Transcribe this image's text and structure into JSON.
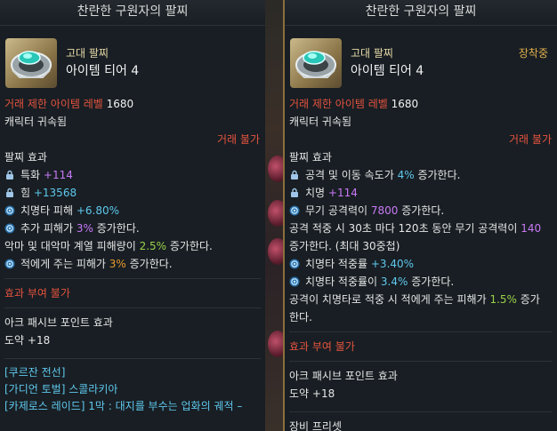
{
  "left": {
    "title": "찬란한 구원자의 팔찌",
    "grade": "고대 팔찌",
    "tier": "아이템 티어 4",
    "level_label": "거래 제한 아이템 레벨",
    "level_value": "1680",
    "bound": "캐릭터 귀속됨",
    "trade": "거래 불가",
    "effects_header": "팔찌 효과",
    "effects": [
      {
        "icon": "lock-icon",
        "parts": [
          "특화 ",
          "+114"
        ]
      },
      {
        "icon": "lock-icon",
        "parts": [
          "힘 ",
          "+13568"
        ]
      },
      {
        "icon": "swirl-icon",
        "parts": [
          "치명타 피해 ",
          "+6.80%"
        ]
      },
      {
        "icon": "swirl-icon",
        "parts": [
          "추가 피해가 ",
          "3%",
          " 증가한다."
        ]
      },
      {
        "icon": "",
        "parts": [
          "악마 및 대악마 계열 피해량이 ",
          "2.5%",
          " 증가한다."
        ]
      },
      {
        "icon": "swirl-icon",
        "parts": [
          "적에게 주는 피해가 ",
          "3%",
          " 증가한다."
        ]
      }
    ],
    "no_effect": "효과 부여 불가",
    "ark_header": "아크 패시브 포인트 효과",
    "ark_value": "도약 +18",
    "sets": [
      "[쿠르잔 전선]",
      "[가디언 토벌] 스콜라키아",
      "[카제로스 레이드] 1막 : 대지를 부수는 업화의 궤적 –"
    ]
  },
  "right": {
    "title": "찬란한 구원자의 팔찌",
    "grade": "고대 팔찌",
    "tier": "아이템 티어 4",
    "equipped": "장착중",
    "level_label": "거래 제한 아이템 레벨",
    "level_value": "1680",
    "bound": "캐릭터 귀속됨",
    "trade": "거래 불가",
    "effects_header": "팔찌 효과",
    "effects": [
      {
        "icon": "lock-icon",
        "parts": [
          "공격 및 이동 속도가 ",
          "4%",
          " 증가한다."
        ]
      },
      {
        "icon": "lock-icon",
        "parts": [
          "치명 ",
          "+114"
        ]
      },
      {
        "icon": "swirl-icon",
        "parts": [
          "무기 공격력이 ",
          "7800",
          " 증가한다."
        ]
      },
      {
        "icon": "",
        "parts": [
          "공격 적중 시 30초 마다 120초 동안 무기 공격력이 ",
          "140"
        ]
      },
      {
        "icon": "",
        "parts": [
          "증가한다. (최대 30중첩)"
        ]
      },
      {
        "icon": "swirl-icon",
        "parts": [
          "치명타 적중률 ",
          "+3.40%"
        ]
      },
      {
        "icon": "swirl-icon",
        "parts": [
          "치명타 적중률이 ",
          "3.4%",
          " 증가한다."
        ]
      },
      {
        "icon": "",
        "parts": [
          "공격이 치명타로 적중 시 적에게 주는 피해가 ",
          "1.5%",
          " 증가"
        ]
      },
      {
        "icon": "",
        "parts": [
          "한다."
        ]
      }
    ],
    "no_effect": "효과 부여 불가",
    "ark_header": "아크 패시브 포인트 효과",
    "ark_value": "도약 +18",
    "footer": "장비 프리셋"
  },
  "colors": {
    "accent_red": "#e5533f",
    "accent_cyan": "#5fc8ee",
    "accent_purple": "#c979f7",
    "accent_orange": "#e89a2c",
    "accent_green": "#9ad04a",
    "equipped_gold": "#e0b04c"
  }
}
